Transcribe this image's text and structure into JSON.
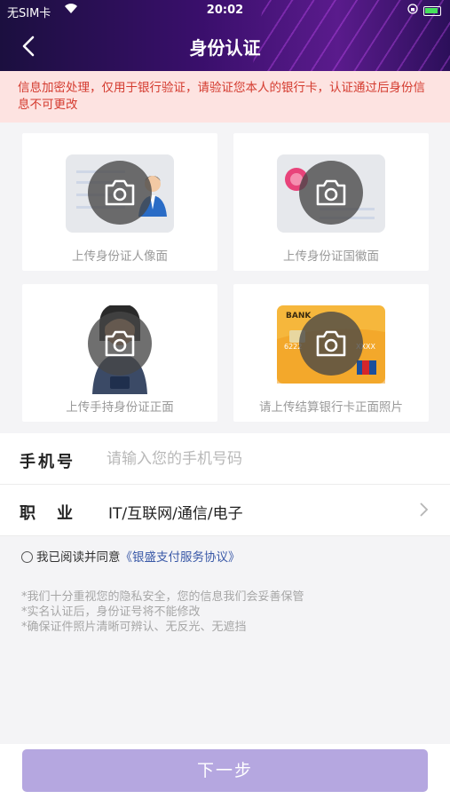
{
  "status_bar": {
    "carrier": "无SIM卡",
    "time": "20:02"
  },
  "nav": {
    "title": "身份认证"
  },
  "notice": "信息加密处理，仅用于银行验证，请验证您本人的银行卡，认证通过后身份信息不可更改",
  "upload_cards": {
    "id_front": "上传身份证人像面",
    "id_back": "上传身份证国徽面",
    "hold_id": "上传手持身份证正面",
    "bank_card": "请上传结算银行卡正面照片",
    "bank_card_text": "BANK",
    "bank_card_number_prefix": "6222",
    "bank_card_number_suffix": "XXXX"
  },
  "form": {
    "phone_label": "手机号",
    "phone_placeholder": "请输入您的手机号码",
    "phone_value": "",
    "job_label": "职　业",
    "job_value": "IT/互联网/通信/电子"
  },
  "agreement": {
    "prefix": "我已阅读并同意",
    "link": "《银盛支付服务协议》"
  },
  "tips": [
    "*我们十分重视您的隐私安全，您的信息我们会妥善保管",
    "*实名认证后，身份证号将不能修改",
    "*确保证件照片清晰可辨认、无反光、无遮挡"
  ],
  "next_button": "下一步",
  "colors": {
    "header_start": "#1b0f3f",
    "header_end": "#5a1b8c",
    "notice_bg": "#fde3e1",
    "notice_text": "#d43b2f",
    "button": "#b5a7e0",
    "link": "#3b5aa8"
  },
  "icons": [
    "wifi-icon",
    "lock-icon",
    "battery-icon",
    "back-icon",
    "camera-icon",
    "chevron-right-icon"
  ]
}
